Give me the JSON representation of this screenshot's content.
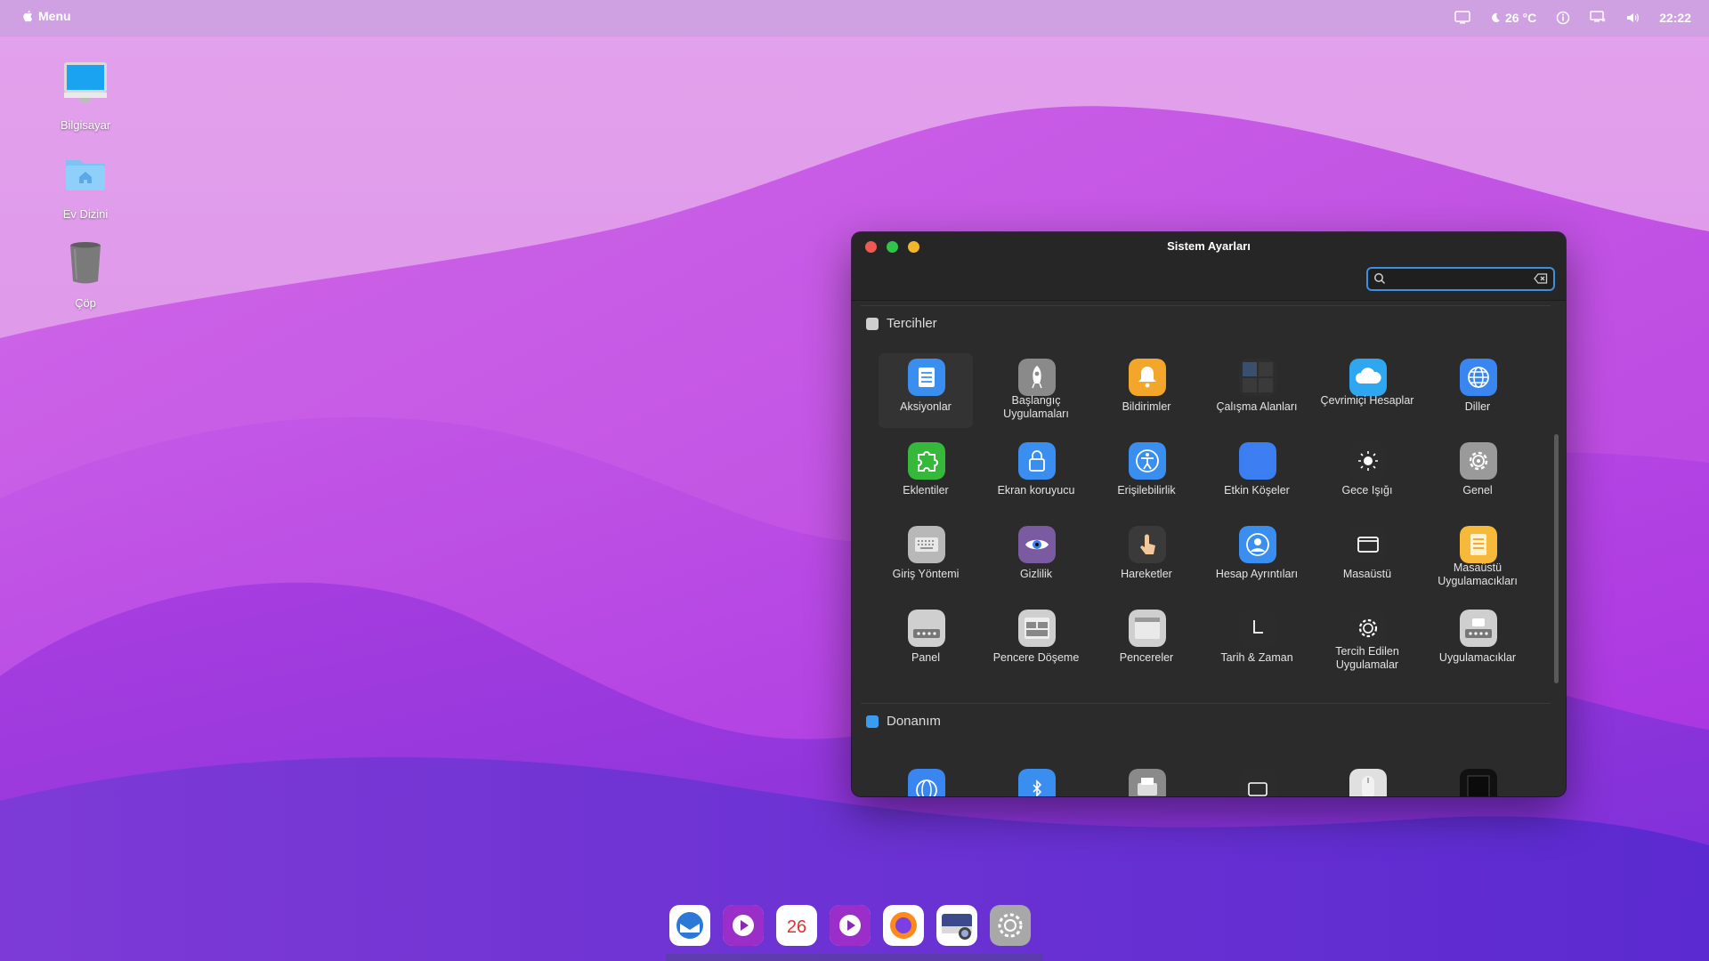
{
  "topbar": {
    "menu_label": "Menu",
    "weather": "26 °C",
    "clock": "22:22"
  },
  "desktop": {
    "icons": [
      {
        "label": "Bilgisayar",
        "icon": "computer-icon"
      },
      {
        "label": "Ev Dizini",
        "icon": "home-folder-icon"
      },
      {
        "label": "Çöp",
        "icon": "trash-icon"
      }
    ]
  },
  "window": {
    "title": "Sistem Ayarları",
    "search": {
      "value": "",
      "placeholder": ""
    },
    "sections": [
      {
        "title": "Tercihler",
        "items": [
          {
            "label": "Aksiyonlar",
            "icon": "actions-icon",
            "color": "#3a8ef0",
            "selected": true
          },
          {
            "label": "Başlangıç Uygulamaları",
            "icon": "rocket-icon",
            "color": "#8a8a8a"
          },
          {
            "label": "Bildirimler",
            "icon": "bell-icon",
            "color": "#f4a62a"
          },
          {
            "label": "Çalışma Alanları",
            "icon": "workspaces-icon",
            "color": "#2e2e2e"
          },
          {
            "label": "Çevrimiçi Hesaplar",
            "icon": "cloud-icon",
            "color": "#2ea7f0"
          },
          {
            "label": "Diller",
            "icon": "globe-icon",
            "color": "#3a86f0"
          },
          {
            "label": "Eklentiler",
            "icon": "puzzle-icon",
            "color": "#36b83a"
          },
          {
            "label": "Ekran koruyucu",
            "icon": "lock-icon",
            "color": "#3a8ef0"
          },
          {
            "label": "Erişilebilirlik",
            "icon": "accessibility-icon",
            "color": "#3a8ef0"
          },
          {
            "label": "Etkin Köşeler",
            "icon": "hot-corners-icon",
            "color": "#3a7ef0"
          },
          {
            "label": "Gece Işığı",
            "icon": "night-light-icon",
            "color": "#2c2c2c"
          },
          {
            "label": "Genel",
            "icon": "gear-icon",
            "color": "#9a9a9a"
          },
          {
            "label": "Giriş Yöntemi",
            "icon": "keyboard-icon",
            "color": "#b8b8b8"
          },
          {
            "label": "Gizlilik",
            "icon": "eye-icon",
            "color": "#7a5aa0"
          },
          {
            "label": "Hareketler",
            "icon": "gesture-hand-icon",
            "color": "#3a3a3a"
          },
          {
            "label": "Hesap Ayrıntıları",
            "icon": "user-icon",
            "color": "#3a8ef0"
          },
          {
            "label": "Masaüstü",
            "icon": "desktop-icon",
            "color": "#2c2c2c"
          },
          {
            "label": "Masaüstü Uygulamacıkları",
            "icon": "desklets-icon",
            "color": "#f6b93a"
          },
          {
            "label": "Panel",
            "icon": "panel-icon",
            "color": "#cfcfcf"
          },
          {
            "label": "Pencere Döşeme",
            "icon": "window-tiling-icon",
            "color": "#cfcfcf"
          },
          {
            "label": "Pencereler",
            "icon": "windows-icon",
            "color": "#cfcfcf"
          },
          {
            "label": "Tarih & Zaman",
            "icon": "clock-icon",
            "color": "#2c2c2c"
          },
          {
            "label": "Tercih Edilen Uygulamalar",
            "icon": "preferred-apps-icon",
            "color": "#2c2c2c"
          },
          {
            "label": "Uygulamacıklar",
            "icon": "applets-icon",
            "color": "#cfcfcf"
          }
        ]
      },
      {
        "title": "Donanım",
        "items": [
          {
            "label": "",
            "icon": "network-icon",
            "color": "#3a86f0"
          },
          {
            "label": "",
            "icon": "bluetooth-icon",
            "color": "#3a8ef0"
          },
          {
            "label": "",
            "icon": "printer-icon",
            "color": "#8a8a8a"
          },
          {
            "label": "",
            "icon": "display-icon",
            "color": "#2c2c2c"
          },
          {
            "label": "",
            "icon": "mouse-icon",
            "color": "#e0e0e0"
          },
          {
            "label": "",
            "icon": "power-icon",
            "color": "#111111"
          }
        ]
      }
    ]
  },
  "dock": {
    "items": [
      {
        "name": "thunderbird-icon",
        "color": "#ffffff"
      },
      {
        "name": "media-player-icon",
        "color": "#ffffff"
      },
      {
        "name": "calendar-icon",
        "color": "#ffffff",
        "text": "26"
      },
      {
        "name": "video-player-icon",
        "color": "#ffffff"
      },
      {
        "name": "firefox-icon",
        "color": "#ffffff"
      },
      {
        "name": "screenshot-icon",
        "color": "#ffffff"
      },
      {
        "name": "settings-icon",
        "color": "#a8a8a8"
      }
    ]
  }
}
